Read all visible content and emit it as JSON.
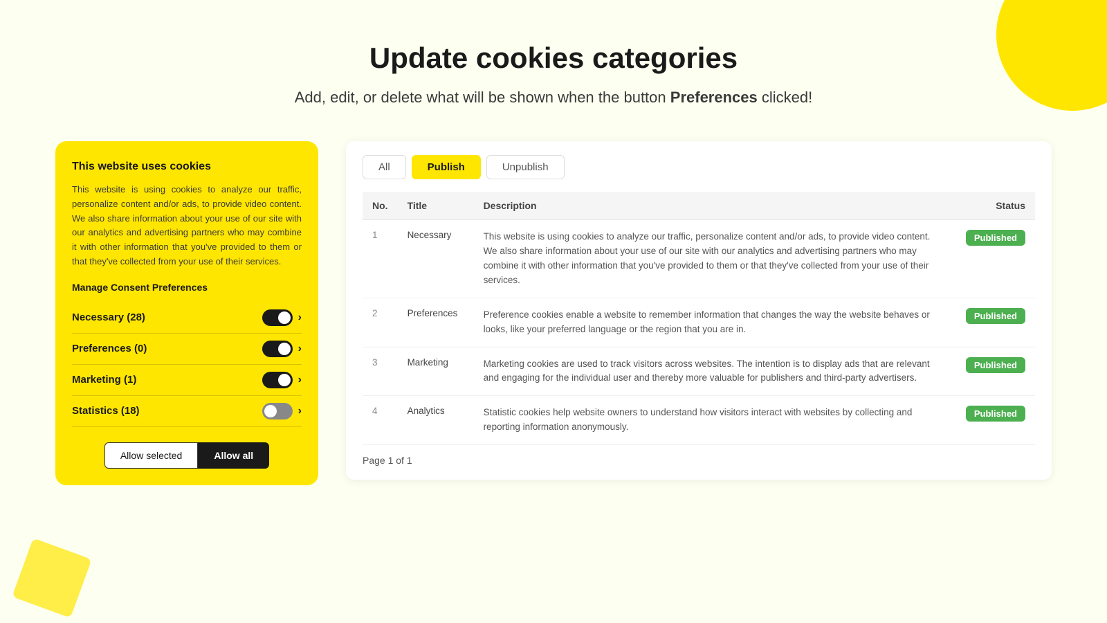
{
  "page": {
    "title": "Update cookies categories",
    "subtitle_before": "Add, edit, or delete what will be shown when the button ",
    "subtitle_bold": "Preferences",
    "subtitle_after": " clicked!"
  },
  "consent_panel": {
    "heading": "This website uses cookies",
    "description": "This website is using cookies to analyze our traffic, personalize content and/or ads, to provide video content. We also share information about your use of our site with our analytics and advertising partners who may combine it with other information that you've provided to them or that they've collected from your use of their services.",
    "manage_title": "Manage Consent Preferences",
    "preferences": [
      {
        "label": "Necessary (28)",
        "enabled": true
      },
      {
        "label": "Preferences (0)",
        "enabled": true
      },
      {
        "label": "Marketing (1)",
        "enabled": true
      },
      {
        "label": "Statistics (18)",
        "enabled": false
      }
    ],
    "btn_allow_selected": "Allow selected",
    "btn_allow_all": "Allow all"
  },
  "toolbar": {
    "tabs": [
      {
        "label": "All",
        "active": false
      },
      {
        "label": "Publish",
        "active": true
      },
      {
        "label": "Unpublish",
        "active": false
      }
    ]
  },
  "table": {
    "columns": [
      {
        "key": "no",
        "label": "No."
      },
      {
        "key": "title",
        "label": "Title"
      },
      {
        "key": "description",
        "label": "Description"
      },
      {
        "key": "status",
        "label": "Status"
      }
    ],
    "rows": [
      {
        "no": "1",
        "title": "Necessary",
        "description": "This website is using cookies to analyze our traffic, personalize content and/or ads, to provide video content. We also share information about your use of our site with our analytics and advertising partners who may combine it with other information that you've provided to them or that they've collected from your use of their services.",
        "status": "Published"
      },
      {
        "no": "2",
        "title": "Preferences",
        "description": "Preference cookies enable a website to remember information that changes the way the website behaves or looks, like your preferred language or the region that you are in.",
        "status": "Published"
      },
      {
        "no": "3",
        "title": "Marketing",
        "description": "Marketing cookies are used to track visitors across websites. The intention is to display ads that are relevant and engaging for the individual user and thereby more valuable for publishers and third-party advertisers.",
        "status": "Published"
      },
      {
        "no": "4",
        "title": "Analytics",
        "description": "Statistic cookies help website owners to understand how visitors interact with websites by collecting and reporting information anonymously.",
        "status": "Published"
      }
    ],
    "footer": "Page 1 of 1"
  }
}
